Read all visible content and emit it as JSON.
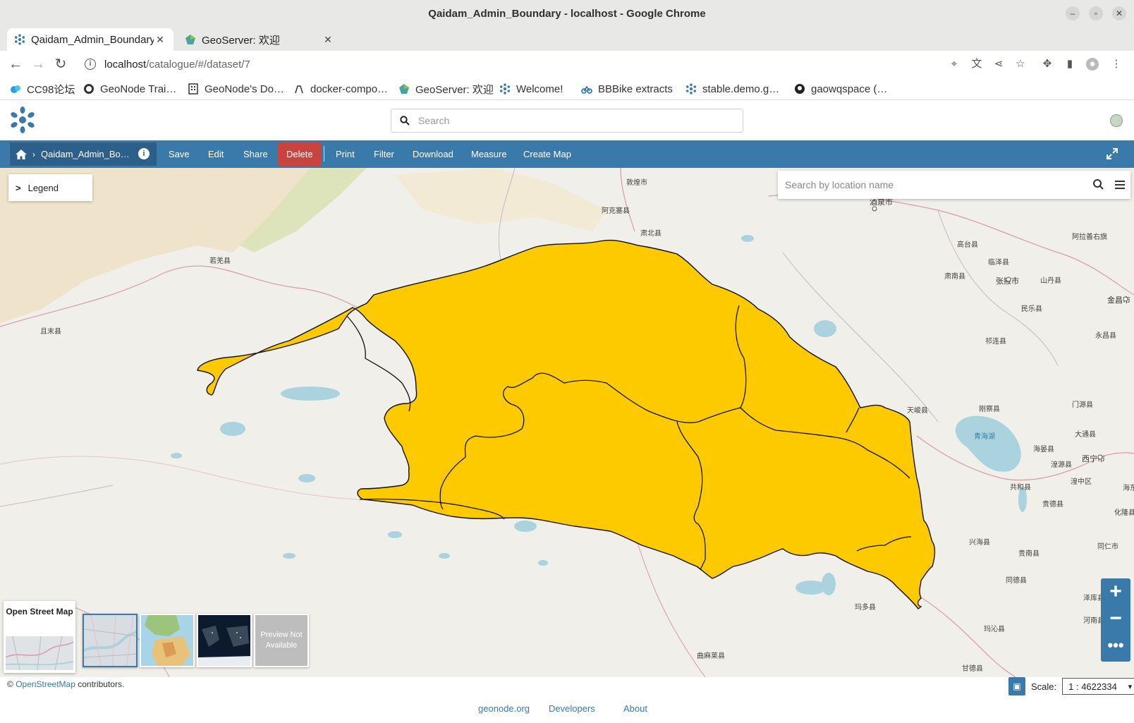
{
  "window": {
    "title": "Qaidam_Admin_Boundary - localhost - Google Chrome"
  },
  "tabs": [
    {
      "label": "Qaidam_Admin_Boundary",
      "active": true
    },
    {
      "label": "GeoServer: 欢迎",
      "active": false
    }
  ],
  "address": {
    "host": "localhost",
    "path": "/catalogue/#/dataset/7"
  },
  "bookmarks": [
    "CC98论坛",
    "GeoNode Trai…",
    "GeoNode's Do…",
    "docker-compo…",
    "GeoServer: 欢迎",
    "Welcome!",
    "BBBike extracts",
    "stable.demo.g…",
    "gaowqspace (…"
  ],
  "geonode": {
    "search_placeholder": "Search",
    "breadcrumb": "Qaidam_Admin_Bo…",
    "actions": {
      "save": "Save",
      "edit": "Edit",
      "share": "Share",
      "delete": "Delete",
      "print": "Print",
      "filter": "Filter",
      "download": "Download",
      "measure": "Measure",
      "create_map": "Create Map"
    }
  },
  "map": {
    "legend_label": "Legend",
    "location_search_placeholder": "Search by location name",
    "background_title": "Open Street Map",
    "preview_not_available": "Preview Not Available",
    "polygon_fill": "#fdca00",
    "place_labels": [
      "敦煌市",
      "阿克塞县",
      "肃北县",
      "酒泉市",
      "若羌县",
      "且末县",
      "高台县",
      "临泽县",
      "肃南县",
      "张掖市",
      "山丹县",
      "阿拉善右旗",
      "金昌市",
      "民乐县",
      "永昌县",
      "祁连县",
      "天峻县",
      "刚察县",
      "门源县",
      "青海湖",
      "大通县",
      "海晏县",
      "西宁市",
      "湟源县",
      "湟中区",
      "共和县",
      "贵德县",
      "化隆县",
      "兴海县",
      "贵南县",
      "同仁市",
      "同德县",
      "泽库县",
      "河南县",
      "玛多县",
      "玛沁县",
      "甘德县",
      "曲麻莱县",
      "海东"
    ]
  },
  "footer": {
    "attribution_prefix": "©",
    "attribution_link": "OpenStreetMap",
    "attribution_suffix": "contributors.",
    "scale_label": "Scale:",
    "scale_value": "1 : 4622334",
    "links": [
      "geonode.org",
      "Developers",
      "About"
    ]
  }
}
